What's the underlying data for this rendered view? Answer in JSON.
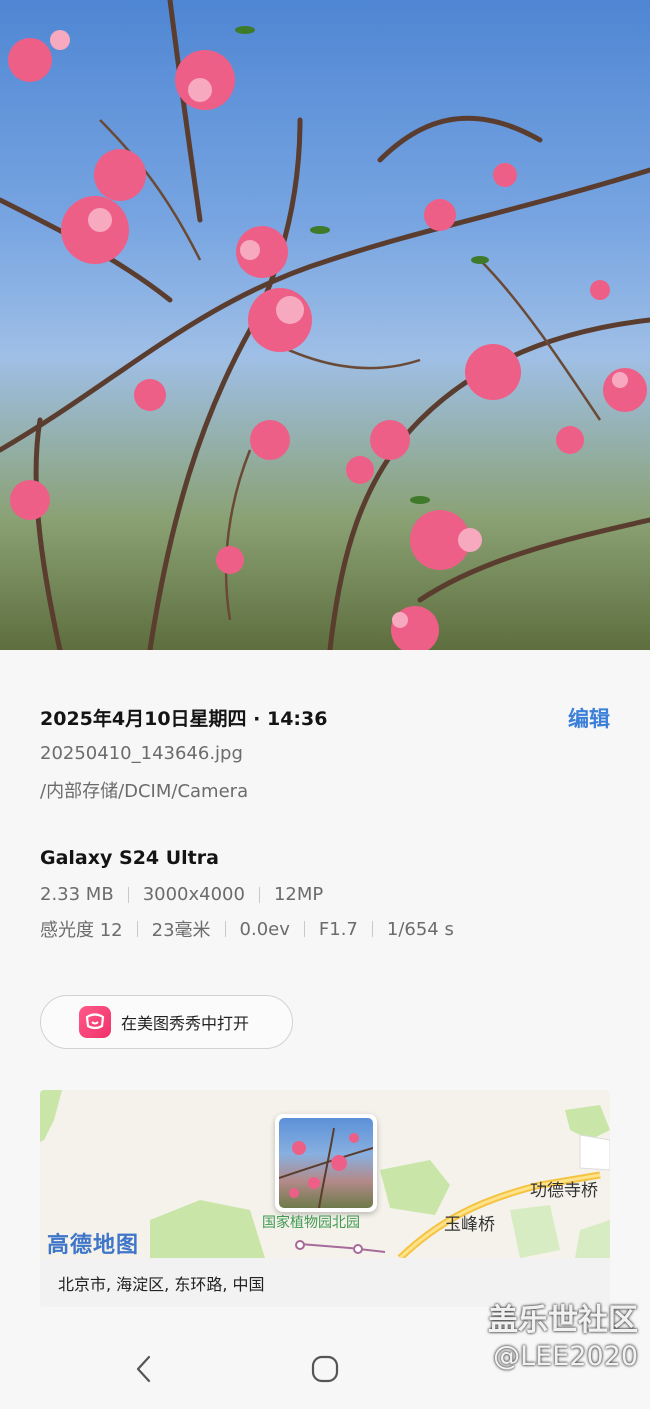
{
  "photo": {
    "alt_icon": "peach-blossom-photo"
  },
  "details": {
    "datetime": "2025年4月10日星期四 · 14:36",
    "edit_label": "编辑",
    "filename": "20250410_143646.jpg",
    "path": "/内部存储/DCIM/Camera"
  },
  "camera": {
    "device": "Galaxy S24 Ultra",
    "row1": [
      "2.33 MB",
      "3000x4000",
      "12MP"
    ],
    "row2": [
      "感光度 12",
      "23毫米",
      "0.0ev",
      "F1.7",
      "1/654 s"
    ]
  },
  "open_with": {
    "label": "在美图秀秀中打开",
    "icon": "meitu-app-icon"
  },
  "map": {
    "provider_logo": "高德地图",
    "poi_garden": "国家植物园北园",
    "poi_yufeng": "玉峰桥",
    "poi_gongde": "功德寺桥",
    "address": "北京市, 海淀区, 东环路, 中国"
  },
  "nav": {
    "back_icon": "back-chevron-icon",
    "home_icon": "home-circle-icon"
  },
  "watermark": {
    "line1": "盖乐世社区",
    "line2": "@LEE2020"
  },
  "colors": {
    "accent": "#3b7fd8",
    "map_green": "#c9e6a8",
    "road_yellow": "#f5c342"
  }
}
